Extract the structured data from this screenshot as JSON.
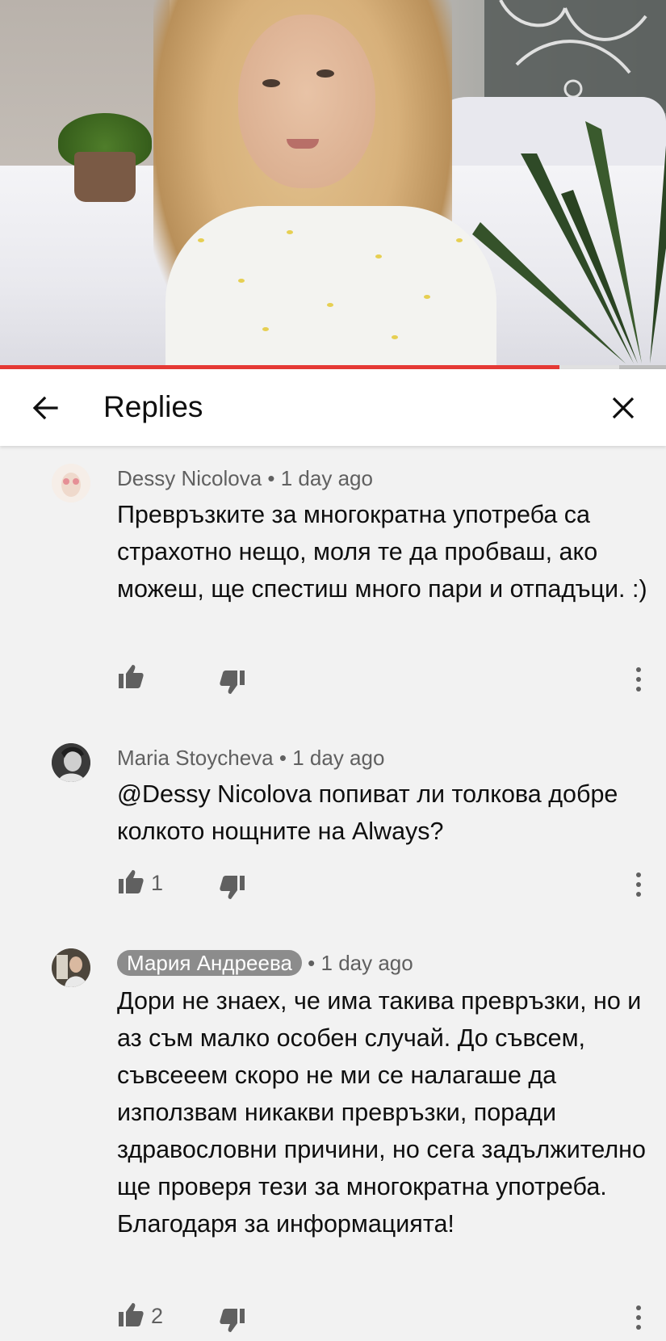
{
  "header": {
    "title": "Replies"
  },
  "player": {
    "progress_fraction": 0.84,
    "buffer_fraction": 0.93
  },
  "comments": [
    {
      "author": "Dessy Nicolova",
      "time": "1 day ago",
      "text": "Превръзките за многократна употреба са страхотно нещо, моля те да пробваш, ако можеш, ще спестиш много пари и отпадъци. :)",
      "likes": ""
    },
    {
      "author": "Maria Stoycheva",
      "time": "1 day ago",
      "text": "@Dessy Nicolova попиват ли толкова добре колкото нощните на Always?",
      "likes": "1"
    },
    {
      "author": "Мария Андреева",
      "time": "1 day ago",
      "text": "Дори не знаех, че има такива превръзки, но и аз съм малко особен случай. До съвсем, съвсееем скоро не ми се налагаше да използвам никакви превръзки, поради здравословни причини, но сега задължително ще проверя тези за многократна употреба. Благодаря за информацията!",
      "likes": "2"
    }
  ],
  "meta_separator": "•",
  "colors": {
    "progress": "#e53935",
    "background": "#f2f2f2",
    "secondary_text": "#606060",
    "author_chip": "#8c8c8c"
  },
  "icons": {
    "back": "arrow-left-icon",
    "close": "close-icon",
    "like": "thumb-up-icon",
    "dislike": "thumb-down-icon",
    "more": "more-vert-icon"
  }
}
